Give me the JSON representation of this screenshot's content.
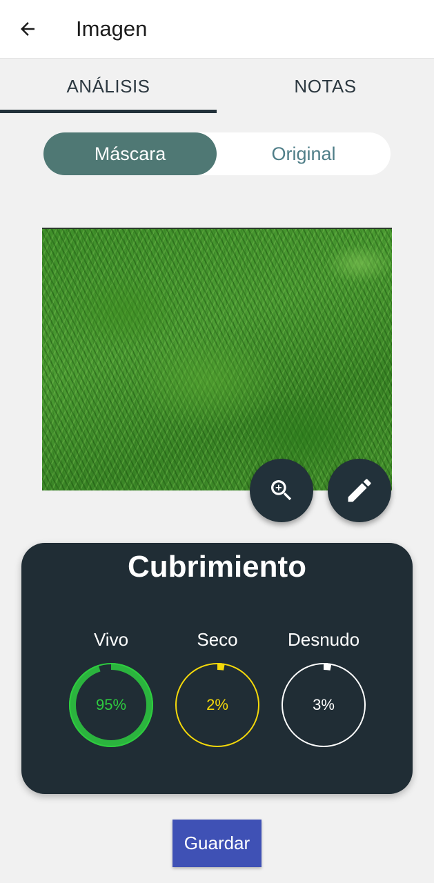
{
  "appbar": {
    "title": "Imagen",
    "back_icon": "arrow-left-icon"
  },
  "tabs": [
    {
      "label": "ANÁLISIS",
      "selected": true
    },
    {
      "label": "NOTAS",
      "selected": false
    }
  ],
  "view_toggle": {
    "options": [
      "Máscara",
      "Original"
    ],
    "selected": "Máscara"
  },
  "image_actions": {
    "zoom_icon": "zoom-in-icon",
    "edit_icon": "pencil-icon"
  },
  "coverage": {
    "title": "Cubrimiento",
    "metrics": [
      {
        "label": "Vivo",
        "value": "95%",
        "fraction": 0.95,
        "color": "#2ecc40"
      },
      {
        "label": "Seco",
        "value": "2%",
        "fraction": 0.02,
        "color": "#f5d90a"
      },
      {
        "label": "Desnudo",
        "value": "3%",
        "fraction": 0.03,
        "color": "#ffffff"
      }
    ]
  },
  "save_label": "Guardar",
  "colors": {
    "primary_dark": "#22313a",
    "toggle_active": "#4f7874",
    "save_button": "#3f51b5"
  }
}
